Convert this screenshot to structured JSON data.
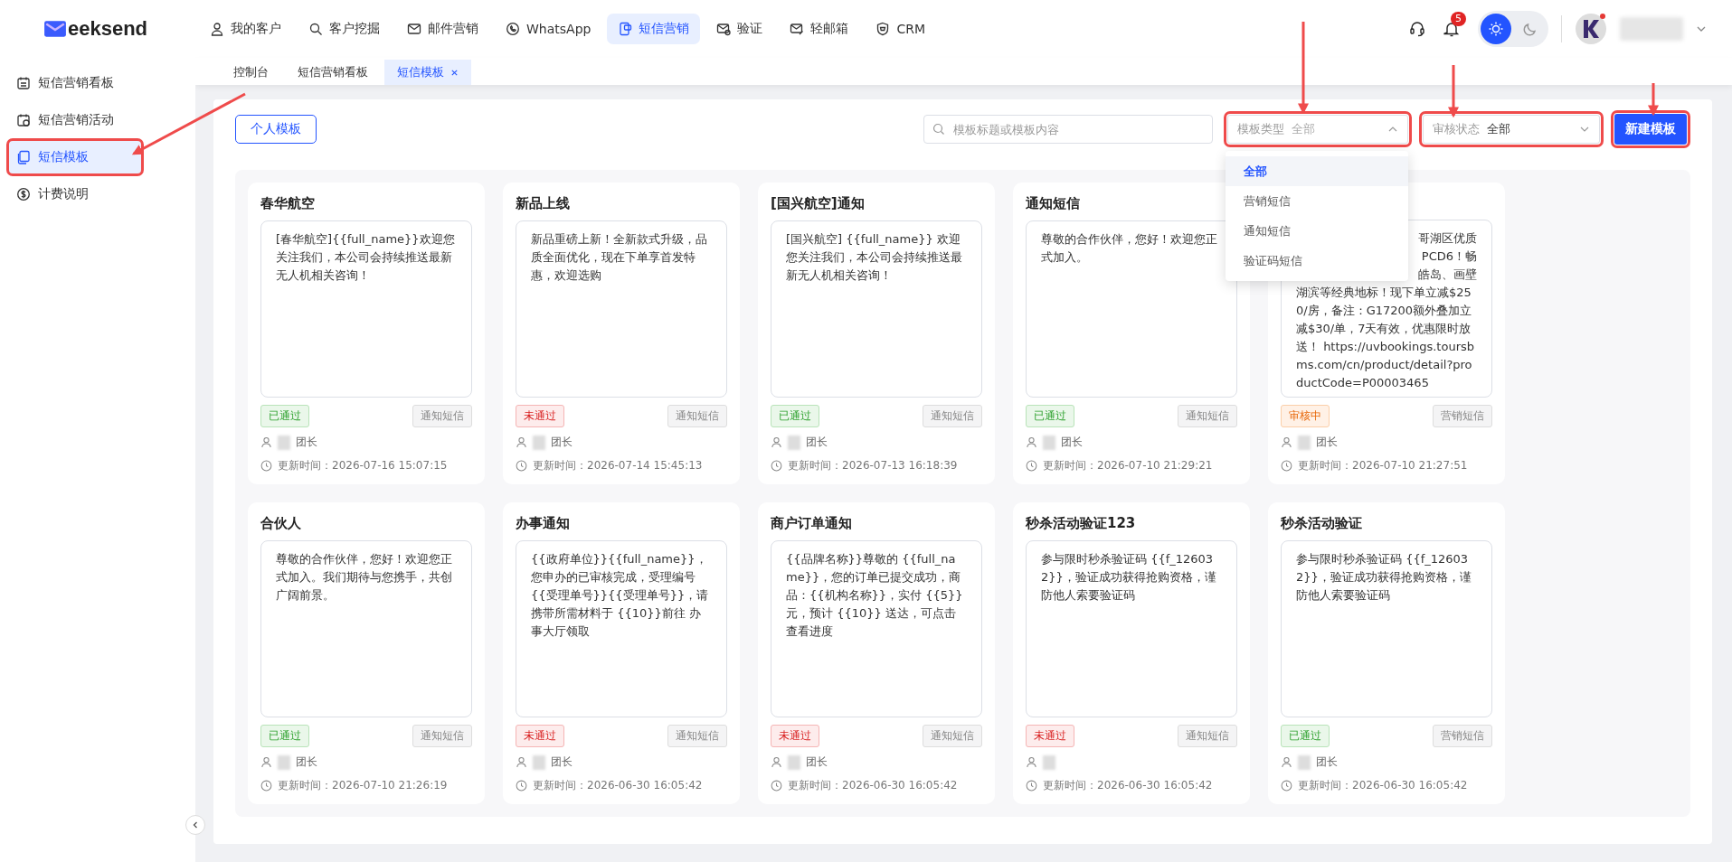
{
  "header": {
    "logo_text": "eeksend",
    "nav": [
      {
        "label": "我的客户",
        "selected": false
      },
      {
        "label": "客户挖掘",
        "selected": false
      },
      {
        "label": "邮件营销",
        "selected": false
      },
      {
        "label": "WhatsApp",
        "selected": false
      },
      {
        "label": "短信营销",
        "selected": true
      },
      {
        "label": "验证",
        "selected": false
      },
      {
        "label": "轻邮箱",
        "selected": false
      },
      {
        "label": "CRM",
        "selected": false
      }
    ],
    "notification_count": "5",
    "theme_toggle": [
      {
        "selected": true
      },
      {
        "selected": false
      }
    ]
  },
  "tabs": [
    {
      "label": "控制台",
      "selected": false,
      "closable": false
    },
    {
      "label": "短信营销看板",
      "selected": false,
      "closable": false
    },
    {
      "label": "短信模板",
      "selected": true,
      "closable": true
    }
  ],
  "sidebar": {
    "items": [
      {
        "label": "短信营销看板",
        "selected": false,
        "highlighted": false
      },
      {
        "label": "短信营销活动",
        "selected": false,
        "highlighted": false
      },
      {
        "label": "短信模板",
        "selected": true,
        "highlighted": true
      },
      {
        "label": "计费说明",
        "selected": false,
        "highlighted": false
      }
    ]
  },
  "toolbar": {
    "personal_button": "个人模板",
    "search": {
      "placeholder": "模板标题或模板内容"
    },
    "type_select": {
      "label": "模板类型",
      "value": "全部",
      "expanded": true,
      "highlighted": true
    },
    "status_select": {
      "label": "审核状态",
      "value": "全部",
      "expanded": false,
      "highlighted": true
    },
    "create_button": {
      "label": "新建模板",
      "highlighted": true
    }
  },
  "type_dropdown": [
    {
      "label": "全部",
      "selected": true
    },
    {
      "label": "营销短信",
      "selected": false
    },
    {
      "label": "通知短信",
      "selected": false
    },
    {
      "label": "验证码短信",
      "selected": false
    }
  ],
  "cards": [
    {
      "title": "春华航空",
      "content": "[春华航空]{{full_name}}欢迎您关注我们，本公司会持续推送最新无人机相关咨询！",
      "status": {
        "label": "已通过",
        "kind": "passed"
      },
      "type": "通知短信",
      "owner": "团长",
      "time": "更新时间：2026-07-16 15:07:15"
    },
    {
      "title": "新品上线",
      "content": "新品重磅上新！全新款式升级，品质全面优化，现在下单享首发特惠，欢迎选购",
      "status": {
        "label": "未通过",
        "kind": "failed"
      },
      "type": "通知短信",
      "owner": "团长",
      "time": "更新时间：2026-07-14 15:45:13"
    },
    {
      "title": "[国兴航空]通知",
      "content": "[国兴航空] {{full_name}} 欢迎您关注我们，本公司会持续推送最新无人机相关咨询！",
      "status": {
        "label": "已通过",
        "kind": "passed"
      },
      "type": "通知短信",
      "owner": "团长",
      "time": "更新时间：2026-07-13 16:18:39"
    },
    {
      "title": "通知短信",
      "content": "尊敬的合作伙伴，您好！欢迎您正式加入。",
      "status": {
        "label": "已通过",
        "kind": "passed"
      },
      "type": "通知短信",
      "owner": "团长",
      "time": "更新时间：2026-07-10 21:29:21"
    },
    {
      "covered_lines": [
        "哥湖区优质",
        "PCD6！畅",
        "皓岛、画壁"
      ],
      "content": "湖滨等经典地标！现下单立减$250/房，备注：G17200额外叠加立减$30/单，7天有效，优惠限时放送！ https://uvbookings.toursbms.com/cn/product/detail?productCode=P00003465",
      "status": {
        "label": "审核中",
        "kind": "pending"
      },
      "type": "营销短信",
      "owner": "团长",
      "time": "更新时间：2026-07-10 21:27:51"
    },
    {
      "title": "合伙人",
      "content": "尊敬的合作伙伴，您好！欢迎您正式加入。我们期待与您携手，共创广阔前景。",
      "status": {
        "label": "已通过",
        "kind": "passed"
      },
      "type": "通知短信",
      "owner": "团长",
      "time": "更新时间：2026-07-10 21:26:19"
    },
    {
      "title": "办事通知",
      "content": "{{政府单位}}{{full_name}}，您申办的已审核完成，受理编号 {{受理单号}}{{受理单号}}，请携带所需材料于 {{10}}前往 办事大厅领取",
      "status": {
        "label": "未通过",
        "kind": "failed"
      },
      "type": "通知短信",
      "owner": "团长",
      "time": "更新时间：2026-06-30 16:05:42"
    },
    {
      "title": "商户订单通知",
      "content": "{{品牌名称}}尊敬的 {{full_name}}，您的订单已提交成功，商品：{{机构名称}}，实付 {{5}} 元，预计 {{10}} 送达，可点击查看进度",
      "status": {
        "label": "未通过",
        "kind": "failed"
      },
      "type": "通知短信",
      "owner": "团长",
      "time": "更新时间：2026-06-30 16:05:42"
    },
    {
      "title": "秒杀活动验证123",
      "content": "参与限时秒杀验证码 {{f_126032}}，验证成功获得抢购资格，谨防他人索要验证码",
      "status": {
        "label": "未通过",
        "kind": "failed"
      },
      "type": "通知短信",
      "time": "更新时间：2026-06-30 16:05:42"
    },
    {
      "title": "秒杀活动验证",
      "content": "参与限时秒杀验证码 {{f_126032}}，验证成功获得抢购资格，谨防他人索要验证码",
      "status": {
        "label": "已通过",
        "kind": "passed"
      },
      "type": "营销短信",
      "owner": "团长",
      "time": "更新时间：2026-06-30 16:05:42"
    }
  ]
}
